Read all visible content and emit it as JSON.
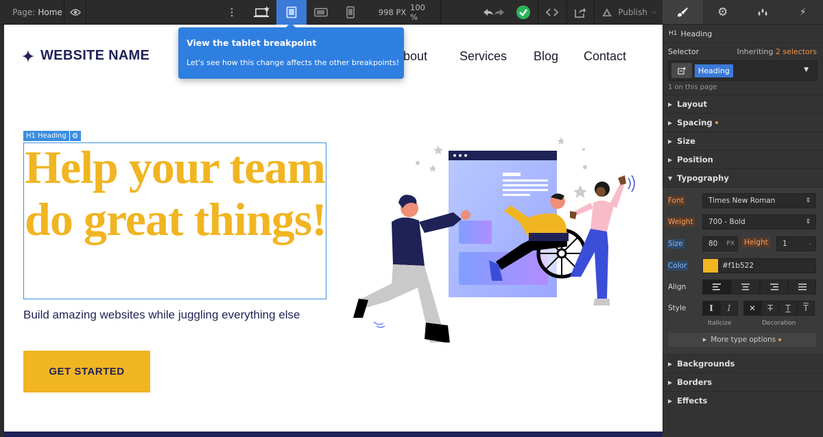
{
  "topbar": {
    "page_label": "Page:",
    "page_name": "Home",
    "width_value": "998 PX",
    "zoom_value": "100 %",
    "publish_label": "Publish"
  },
  "tooltip": {
    "title": "View the tablet breakpoint",
    "body": "Let's see how this change affects the other breakpoints!"
  },
  "site": {
    "logo_text": "WEBSITE NAME",
    "nav": [
      "About",
      "Services",
      "Blog",
      "Contact"
    ],
    "heading_badge": "H1 Heading",
    "hero_heading": "Help your team do great things!",
    "hero_sub": "Build amazing websites while juggling everything else",
    "cta_label": "GET STARTED",
    "heading_color": "#f1b522",
    "text_color": "#1a1a5e"
  },
  "panel": {
    "element_tag": "H1",
    "element_type": "Heading",
    "selector_label": "Selector",
    "inheriting_prefix": "Inheriting",
    "inheriting_link": "2 selectors",
    "selector_chip": "Heading",
    "on_page": "1 on this page",
    "sections_top": [
      {
        "label": "Layout",
        "dot": false
      },
      {
        "label": "Spacing",
        "dot": true
      },
      {
        "label": "Size",
        "dot": false
      },
      {
        "label": "Position",
        "dot": false
      }
    ],
    "typography": {
      "label": "Typography",
      "font_label": "Font",
      "font_value": "Times New Roman",
      "weight_label": "Weight",
      "weight_value": "700 - Bold",
      "size_label": "Size",
      "size_value": "80",
      "size_unit": "PX",
      "height_label": "Height",
      "height_value": "1",
      "height_unit": "-",
      "color_label": "Color",
      "color_value": "#f1b522",
      "align_label": "Align",
      "style_label": "Style",
      "italicize_caption": "Italicize",
      "decoration_caption": "Decoration",
      "more_options": "More type options"
    },
    "sections_bottom": [
      {
        "label": "Backgrounds"
      },
      {
        "label": "Borders"
      },
      {
        "label": "Effects"
      }
    ]
  }
}
